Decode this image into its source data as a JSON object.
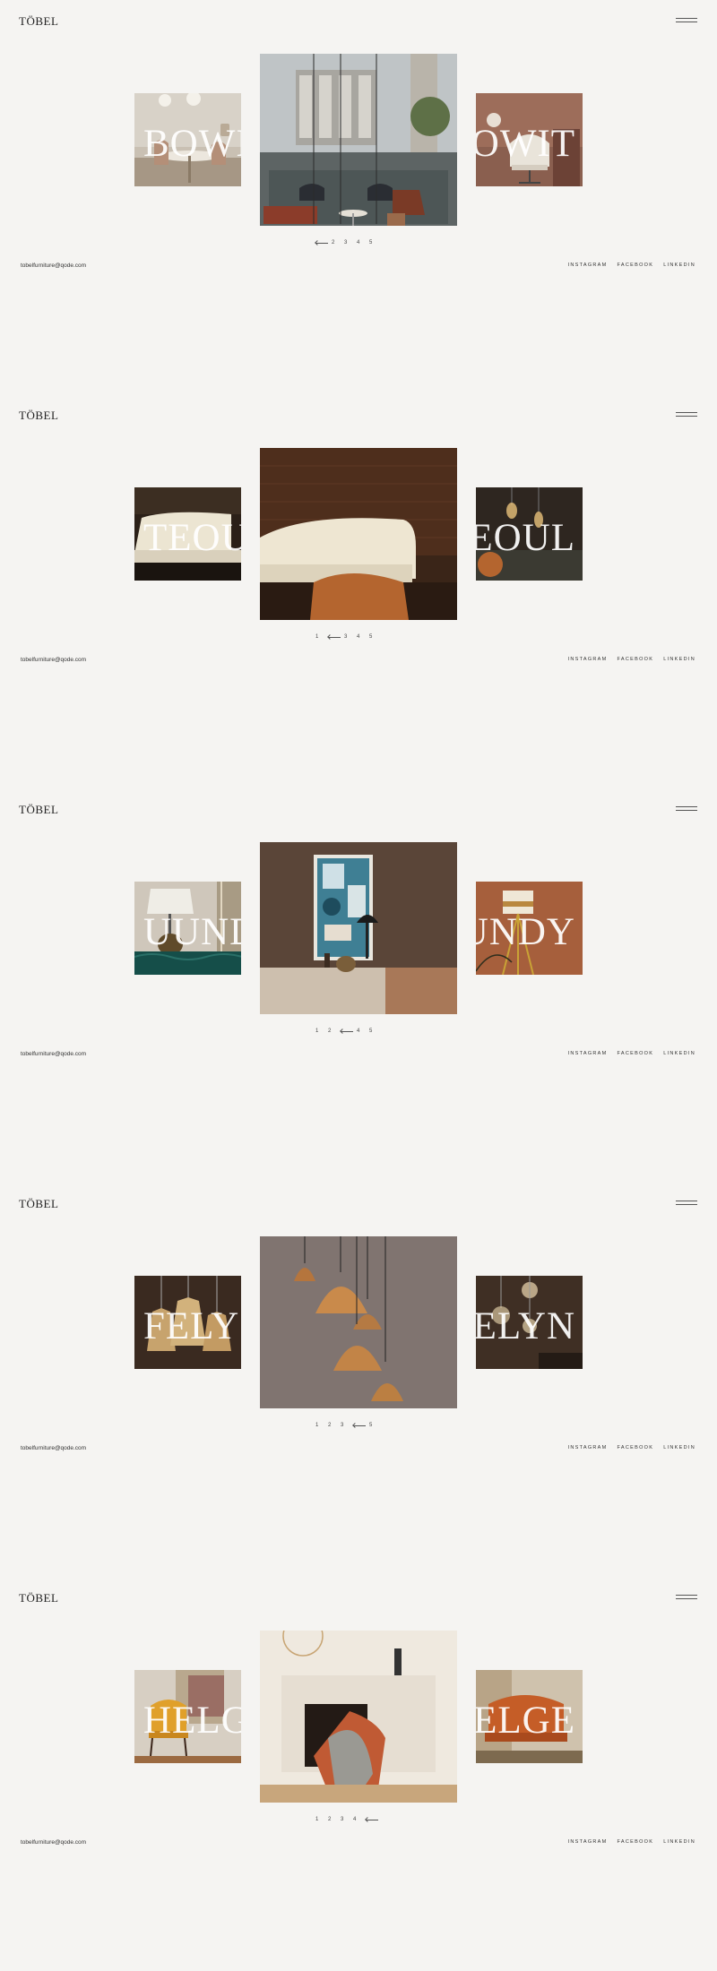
{
  "brand": {
    "logo": "TÖBEL"
  },
  "footer": {
    "email": "tobelfurniture@qode.com",
    "social": [
      "INSTAGRAM",
      "FACEBOOK",
      "LINKEDIN"
    ]
  },
  "screens": [
    {
      "word_left": "BOWI",
      "word_right": "BOWIT",
      "pager": [
        "1",
        "2",
        "3",
        "4",
        "5"
      ],
      "active_page": 1,
      "images": {
        "left": "dining-room-photo",
        "main": "building-lobby-lounge-photo",
        "right": "armchair-corner-photo"
      }
    },
    {
      "word_left": "TEOU",
      "word_right": "TEOUL",
      "pager": [
        "1",
        "2",
        "3",
        "4",
        "5"
      ],
      "active_page": 2,
      "images": {
        "left": "cream-sofa-photo",
        "main": "cream-sofa-orange-chair-photo",
        "right": "pendant-bulbs-photo"
      }
    },
    {
      "word_left": "UUNDY",
      "word_right": "UUNDY",
      "pager": [
        "1",
        "2",
        "3",
        "4",
        "5"
      ],
      "active_page": 3,
      "images": {
        "left": "table-lamp-photo",
        "main": "console-table-artwork-photo",
        "right": "tripod-floor-lamp-photo"
      }
    },
    {
      "word_left": "FELY",
      "word_right": "FELYN",
      "pager": [
        "1",
        "2",
        "3",
        "4",
        "5"
      ],
      "active_page": 4,
      "images": {
        "left": "wooden-pendants-photo",
        "main": "copper-pendant-lamps-photo",
        "right": "glass-globe-pendants-photo"
      }
    },
    {
      "word_left": "HELGE",
      "word_right": "HELGE",
      "pager": [
        "1",
        "2",
        "3",
        "4",
        "5"
      ],
      "active_page": 5,
      "images": {
        "left": "yellow-armchair-photo",
        "main": "fireplace-lounge-chair-photo",
        "right": "orange-armchair-photo"
      }
    }
  ]
}
